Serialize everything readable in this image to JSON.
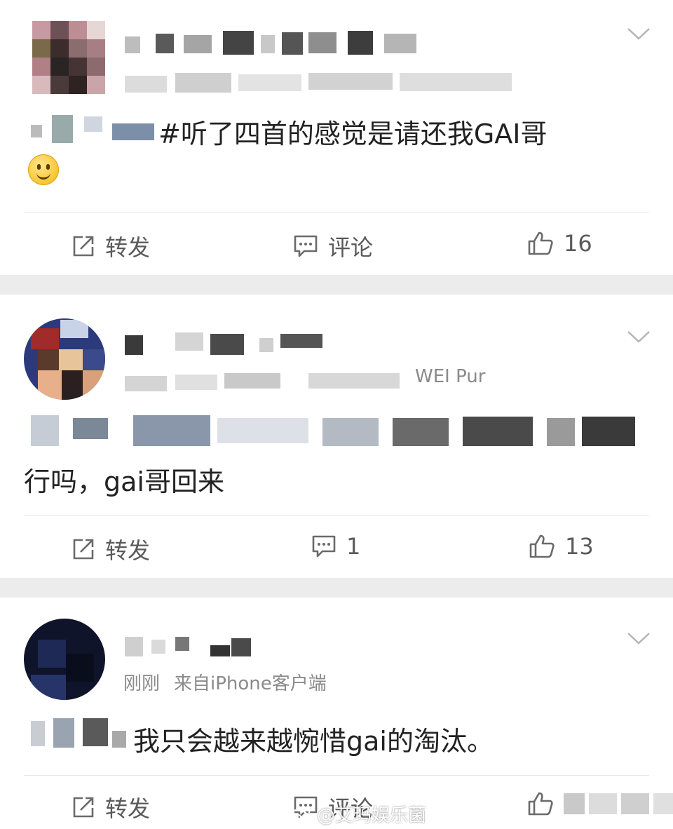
{
  "posts": [
    {
      "body": "#听了四首的感觉是请还我GAI哥",
      "actions": {
        "repost": "转发",
        "comment": "评论",
        "likes": "16"
      }
    },
    {
      "meta_partial": "WEI Pur",
      "body_line2": "行吗，gai哥回来",
      "actions": {
        "repost": "转发",
        "comment": "1",
        "likes": "13"
      }
    },
    {
      "meta_time": "刚刚",
      "meta_source": "来自iPhone客户端",
      "body": "我只会越来越惋惜gai的淘汰。",
      "actions": {
        "repost": "转发",
        "comment": "评论"
      }
    }
  ],
  "watermark": {
    "text": "@艾玛娱乐菌"
  },
  "icons": [
    "chevron-down-icon",
    "repost-icon",
    "comment-icon",
    "like-icon",
    "smile-emoji-icon",
    "weibo-logo-icon"
  ],
  "colors": {
    "background": "#ececec",
    "card": "#ffffff",
    "text": "#222222",
    "meta": "#8a8a8a",
    "action": "#5a5a5a"
  }
}
